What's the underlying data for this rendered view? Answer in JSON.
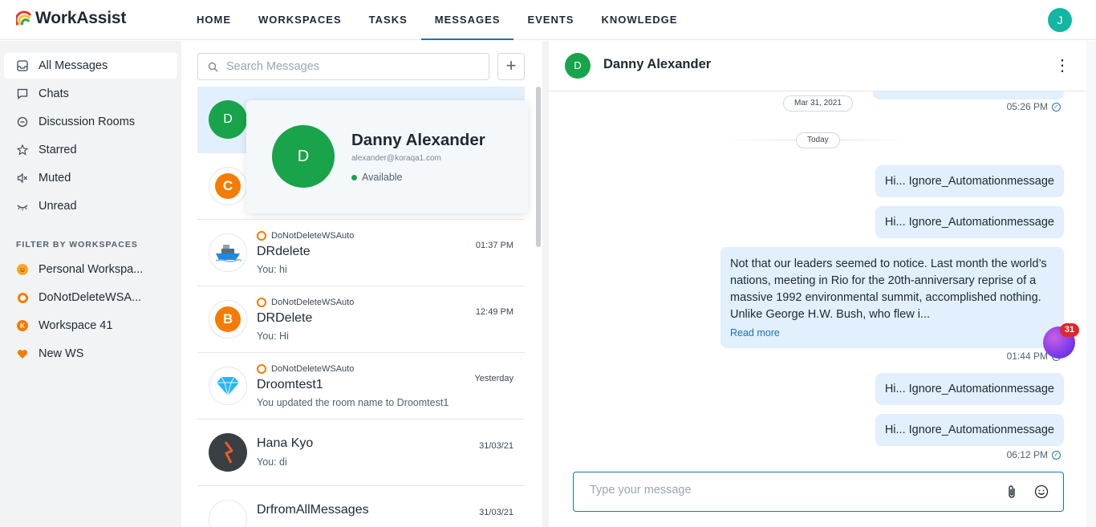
{
  "app": {
    "name": "WorkAssist"
  },
  "nav": {
    "items": [
      "HOME",
      "WORKSPACES",
      "TASKS",
      "MESSAGES",
      "EVENTS",
      "KNOWLEDGE"
    ],
    "active": "MESSAGES",
    "user_initial": "J"
  },
  "sidebar": {
    "items": [
      {
        "label": "All Messages",
        "icon": "inbox-icon"
      },
      {
        "label": "Chats",
        "icon": "chat-icon"
      },
      {
        "label": "Discussion Rooms",
        "icon": "discussion-icon"
      },
      {
        "label": "Starred",
        "icon": "star-icon"
      },
      {
        "label": "Muted",
        "icon": "mute-icon"
      },
      {
        "label": "Unread",
        "icon": "unread-icon"
      }
    ],
    "filter_heading": "FILTER BY WORKSPACES",
    "workspaces": [
      {
        "label": "Personal Workspa...",
        "icon": "smiley-icon",
        "color": "#f9a825"
      },
      {
        "label": "DoNotDeleteWSA...",
        "icon": "ring-icon",
        "color": "#f57c00"
      },
      {
        "label": "Workspace 41",
        "icon": "k-icon",
        "color": "#f57c00",
        "letter": "K"
      },
      {
        "label": "New WS",
        "icon": "heart-icon",
        "color": "#f57c00"
      }
    ]
  },
  "list": {
    "search_placeholder": "Search Messages",
    "add_label": "+",
    "conversations": [
      {
        "initial": "D",
        "avatar_color": "#19a34a"
      },
      {
        "initial": "C",
        "avatar_color": "#f57c00"
      },
      {
        "workspace": "DoNotDeleteWSAuto",
        "name": "DRdelete",
        "time": "01:37 PM",
        "preview": "You: hi",
        "avatar": "ship-icon"
      },
      {
        "workspace": "DoNotDeleteWSAuto",
        "name": "DRDelete",
        "time": "12:49 PM",
        "preview": "You: Hi",
        "initial": "B",
        "avatar_color": "#f57c00"
      },
      {
        "workspace": "DoNotDeleteWSAuto",
        "name": "Droomtest1",
        "time": "Yesterday",
        "preview": "You updated the room name to Droomtest1",
        "avatar": "diamond-icon"
      },
      {
        "name": "Hana Kyo",
        "time": "31/03/21",
        "preview": "You: di",
        "avatar": "bolt-icon"
      },
      {
        "name": "DrfromAllMessages",
        "time": "31/03/21"
      }
    ]
  },
  "popover": {
    "initial": "D",
    "name": "Danny Alexander",
    "email": "alexander@koraqa1.com",
    "status": "Available"
  },
  "chat": {
    "contact_initial": "D",
    "contact_name": "Danny Alexander",
    "menu_icon": "more-vertical-icon",
    "date_pill_1": "Mar 31, 2021",
    "time_1": "05:26 PM",
    "date_pill_2": "Today",
    "messages": [
      "Hi... Ignore_Automationmessage",
      "Hi... Ignore_Automationmessage",
      "Hi... Ignore_Automationmessage",
      "Hi... Ignore_Automationmessage"
    ],
    "long_message": "Not that our leaders seemed to notice. Last month the world’s nations, meeting in Rio for the 20th-anniversary reprise of a massive 1992 environmental summit, accomplished nothing. Unlike George H.W. Bush, who flew i...",
    "read_more": "Read more",
    "time_2": "01:44 PM",
    "time_3": "06:12 PM",
    "composer_placeholder": "Type your message",
    "badge_count": "31"
  }
}
